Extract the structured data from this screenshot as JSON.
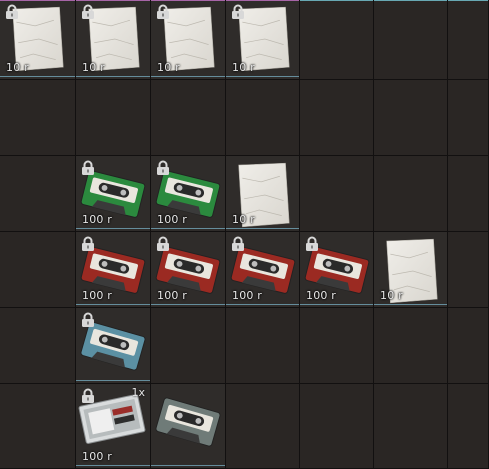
{
  "palette": {
    "paper": "#d9d6cf",
    "tape_green": "#2b8a3e",
    "tape_red": "#9b2a22",
    "tape_blue": "#5b90a3",
    "tape_gray": "#6f7b78",
    "slot_highlight_pink": "#b56bb5",
    "slot_highlight_teal": "#6fb7c3"
  },
  "grid": {
    "columns": 7,
    "rows": 6
  },
  "items": [
    {
      "col": 0,
      "row": 0,
      "icon": "paper-note-icon",
      "locked": true,
      "price": "10 r",
      "count": ""
    },
    {
      "col": 1,
      "row": 0,
      "icon": "paper-note-icon",
      "locked": true,
      "price": "10 r",
      "count": ""
    },
    {
      "col": 2,
      "row": 0,
      "icon": "paper-note-icon",
      "locked": true,
      "price": "10 r",
      "count": ""
    },
    {
      "col": 3,
      "row": 0,
      "icon": "paper-note-icon",
      "locked": true,
      "price": "10 r",
      "count": ""
    },
    {
      "col": 1,
      "row": 2,
      "icon": "cassette-green-icon",
      "locked": true,
      "price": "100 r",
      "count": ""
    },
    {
      "col": 2,
      "row": 2,
      "icon": "cassette-green-icon",
      "locked": true,
      "price": "100 r",
      "count": ""
    },
    {
      "col": 3,
      "row": 2,
      "icon": "paper-note-icon",
      "locked": false,
      "price": "10 r",
      "count": ""
    },
    {
      "col": 1,
      "row": 3,
      "icon": "cassette-red-icon",
      "locked": true,
      "price": "100 r",
      "count": ""
    },
    {
      "col": 2,
      "row": 3,
      "icon": "cassette-red-icon",
      "locked": true,
      "price": "100 r",
      "count": ""
    },
    {
      "col": 3,
      "row": 3,
      "icon": "cassette-red-icon",
      "locked": true,
      "price": "100 r",
      "count": ""
    },
    {
      "col": 4,
      "row": 3,
      "icon": "cassette-red-icon",
      "locked": true,
      "price": "100 r",
      "count": ""
    },
    {
      "col": 5,
      "row": 3,
      "icon": "paper-note-icon",
      "locked": false,
      "price": "10 r",
      "count": ""
    },
    {
      "col": 1,
      "row": 4,
      "icon": "cassette-blue-icon",
      "locked": true,
      "price": "",
      "count": ""
    },
    {
      "col": 1,
      "row": 5,
      "icon": "cassette-case-icon",
      "locked": true,
      "price": "100 r",
      "count": "1x"
    },
    {
      "col": 2,
      "row": 5,
      "icon": "cassette-gray-icon",
      "locked": false,
      "price": "",
      "count": ""
    }
  ]
}
